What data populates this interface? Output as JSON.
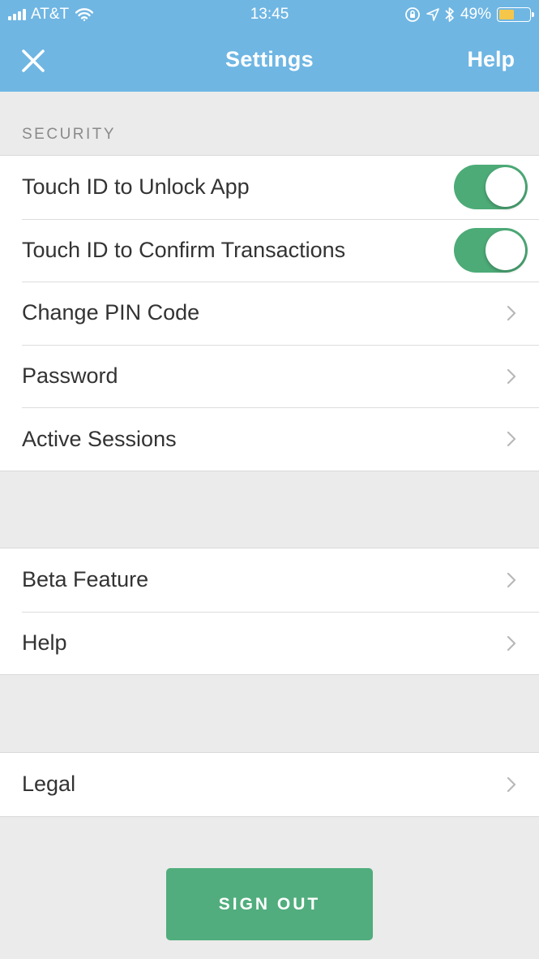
{
  "status_bar": {
    "carrier": "AT&T",
    "time": "13:45",
    "battery_percent": "49%",
    "battery_level": 0.49,
    "signal_bars": 4,
    "icons": [
      "signal-icon",
      "wifi-icon",
      "orientation-lock-icon",
      "location-icon",
      "bluetooth-icon",
      "battery-icon"
    ]
  },
  "nav": {
    "title": "Settings",
    "help_label": "Help",
    "close_icon": "close-icon"
  },
  "security": {
    "section_label": "SECURITY",
    "items": [
      {
        "label": "Touch ID to Unlock App",
        "toggle_on": true
      },
      {
        "label": "Touch ID to Confirm Transactions",
        "toggle_on": true
      },
      {
        "label": "Change PIN Code"
      },
      {
        "label": "Password"
      },
      {
        "label": "Active Sessions"
      }
    ]
  },
  "misc": {
    "items": [
      {
        "label": "Beta Feature"
      },
      {
        "label": "Help"
      }
    ]
  },
  "legal": {
    "items": [
      {
        "label": "Legal"
      }
    ]
  },
  "sign_out_label": "SIGN OUT",
  "colors": {
    "header": "#6fb6e3",
    "toggle_on": "#4dab77",
    "sign_out": "#51ad7d",
    "background": "#ebebeb",
    "battery": "#f6c64b"
  }
}
